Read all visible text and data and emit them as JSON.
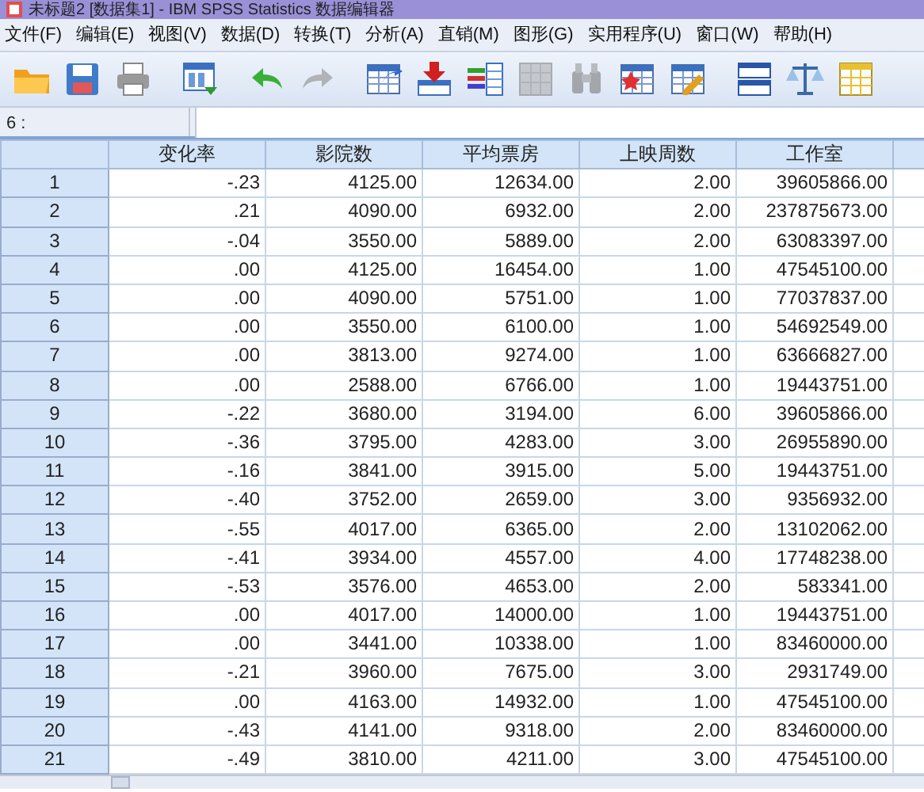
{
  "window": {
    "title": "未标题2 [数据集1] - IBM SPSS Statistics 数据编辑器"
  },
  "menu": [
    "文件(F)",
    "编辑(E)",
    "视图(V)",
    "数据(D)",
    "转换(T)",
    "分析(A)",
    "直销(M)",
    "图形(G)",
    "实用程序(U)",
    "窗口(W)",
    "帮助(H)"
  ],
  "toolbar": [
    {
      "disabled": false
    },
    {
      "disabled": false
    },
    {
      "disabled": false
    },
    {
      "disabled": false
    },
    {
      "disabled": false
    },
    {
      "disabled": true
    },
    {
      "disabled": false
    },
    {
      "disabled": false
    },
    {
      "disabled": false
    },
    {
      "disabled": true
    },
    {
      "disabled": true
    },
    {
      "disabled": false
    },
    {
      "disabled": false
    },
    {
      "disabled": false
    },
    {
      "disabled": false
    },
    {
      "disabled": false
    }
  ],
  "cell_editor": {
    "label": "6 :"
  },
  "table": {
    "columns": [
      "变化率",
      "影院数",
      "平均票房",
      "上映周数",
      "工作室"
    ],
    "rows": [
      {
        "number": "1",
        "cells": [
          "-.23",
          "4125.00",
          "12634.00",
          "2.00",
          "39605866.00"
        ]
      },
      {
        "number": "2",
        "cells": [
          ".21",
          "4090.00",
          "6932.00",
          "2.00",
          "237875673.00"
        ]
      },
      {
        "number": "3",
        "cells": [
          "-.04",
          "3550.00",
          "5889.00",
          "2.00",
          "63083397.00"
        ]
      },
      {
        "number": "4",
        "cells": [
          ".00",
          "4125.00",
          "16454.00",
          "1.00",
          "47545100.00"
        ]
      },
      {
        "number": "5",
        "cells": [
          ".00",
          "4090.00",
          "5751.00",
          "1.00",
          "77037837.00"
        ]
      },
      {
        "number": "6",
        "cells": [
          ".00",
          "3550.00",
          "6100.00",
          "1.00",
          "54692549.00"
        ]
      },
      {
        "number": "7",
        "cells": [
          ".00",
          "3813.00",
          "9274.00",
          "1.00",
          "63666827.00"
        ]
      },
      {
        "number": "8",
        "cells": [
          ".00",
          "2588.00",
          "6766.00",
          "1.00",
          "19443751.00"
        ]
      },
      {
        "number": "9",
        "cells": [
          "-.22",
          "3680.00",
          "3194.00",
          "6.00",
          "39605866.00"
        ]
      },
      {
        "number": "10",
        "cells": [
          "-.36",
          "3795.00",
          "4283.00",
          "3.00",
          "26955890.00"
        ]
      },
      {
        "number": "11",
        "cells": [
          "-.16",
          "3841.00",
          "3915.00",
          "5.00",
          "19443751.00"
        ]
      },
      {
        "number": "12",
        "cells": [
          "-.40",
          "3752.00",
          "2659.00",
          "3.00",
          "9356932.00"
        ]
      },
      {
        "number": "13",
        "cells": [
          "-.55",
          "4017.00",
          "6365.00",
          "2.00",
          "13102062.00"
        ]
      },
      {
        "number": "14",
        "cells": [
          "-.41",
          "3934.00",
          "4557.00",
          "4.00",
          "17748238.00"
        ]
      },
      {
        "number": "15",
        "cells": [
          "-.53",
          "3576.00",
          "4653.00",
          "2.00",
          "583341.00"
        ]
      },
      {
        "number": "16",
        "cells": [
          ".00",
          "4017.00",
          "14000.00",
          "1.00",
          "19443751.00"
        ]
      },
      {
        "number": "17",
        "cells": [
          ".00",
          "3441.00",
          "10338.00",
          "1.00",
          "83460000.00"
        ]
      },
      {
        "number": "18",
        "cells": [
          "-.21",
          "3960.00",
          "7675.00",
          "3.00",
          "2931749.00"
        ]
      },
      {
        "number": "19",
        "cells": [
          ".00",
          "4163.00",
          "14932.00",
          "1.00",
          "47545100.00"
        ]
      },
      {
        "number": "20",
        "cells": [
          "-.43",
          "4141.00",
          "9318.00",
          "2.00",
          "83460000.00"
        ]
      },
      {
        "number": "21",
        "cells": [
          "-.49",
          "3810.00",
          "4211.00",
          "3.00",
          "47545100.00"
        ]
      }
    ]
  }
}
